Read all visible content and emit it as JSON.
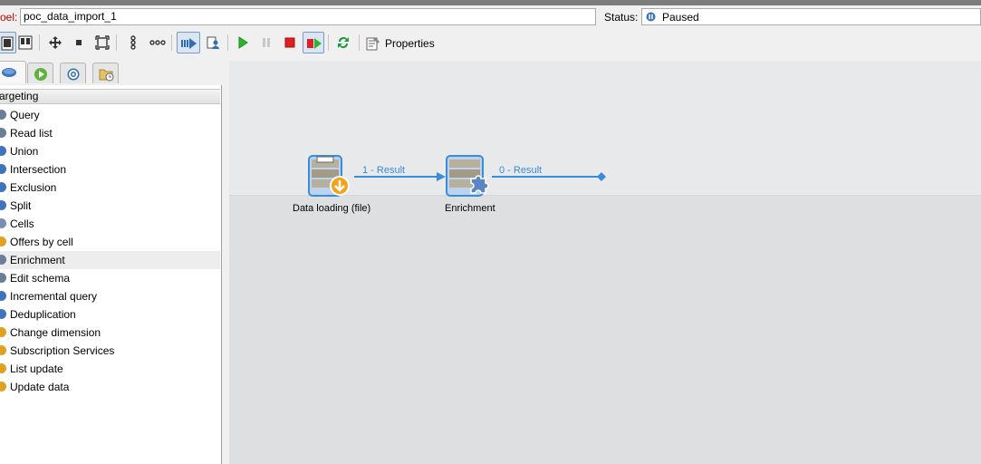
{
  "header": {
    "label_caption": "oel:",
    "label_value": "poc_data_import_1",
    "status_caption": "Status:",
    "status_value": "Paused"
  },
  "toolbar": {
    "properties_label": "Properties"
  },
  "palette": {
    "category": "argeting",
    "items": [
      {
        "label": "Query",
        "icon": "query-icon"
      },
      {
        "label": "Read list",
        "icon": "read-list-icon"
      },
      {
        "label": "Union",
        "icon": "union-icon"
      },
      {
        "label": "Intersection",
        "icon": "intersection-icon"
      },
      {
        "label": "Exclusion",
        "icon": "exclusion-icon"
      },
      {
        "label": "Split",
        "icon": "split-icon"
      },
      {
        "label": "Cells",
        "icon": "cells-icon"
      },
      {
        "label": "Offers by cell",
        "icon": "offers-icon"
      },
      {
        "label": "Enrichment",
        "icon": "enrichment-icon"
      },
      {
        "label": "Edit schema",
        "icon": "edit-schema-icon"
      },
      {
        "label": "Incremental query",
        "icon": "incremental-query-icon"
      },
      {
        "label": "Deduplication",
        "icon": "deduplication-icon"
      },
      {
        "label": "Change dimension",
        "icon": "change-dimension-icon"
      },
      {
        "label": "Subscription Services",
        "icon": "subscription-icon"
      },
      {
        "label": "List update",
        "icon": "list-update-icon"
      },
      {
        "label": "Update data",
        "icon": "update-data-icon"
      }
    ],
    "selected_index": 8
  },
  "workflow": {
    "nodes": [
      {
        "label": "Data loading (file)"
      },
      {
        "label": "Enrichment"
      }
    ],
    "transitions": [
      {
        "label": "1 - Result"
      },
      {
        "label": "0 - Result"
      }
    ]
  },
  "colors": {
    "transition": "#3a8bd8",
    "accent": "#2f6fb6",
    "label_red": "#c00000"
  }
}
